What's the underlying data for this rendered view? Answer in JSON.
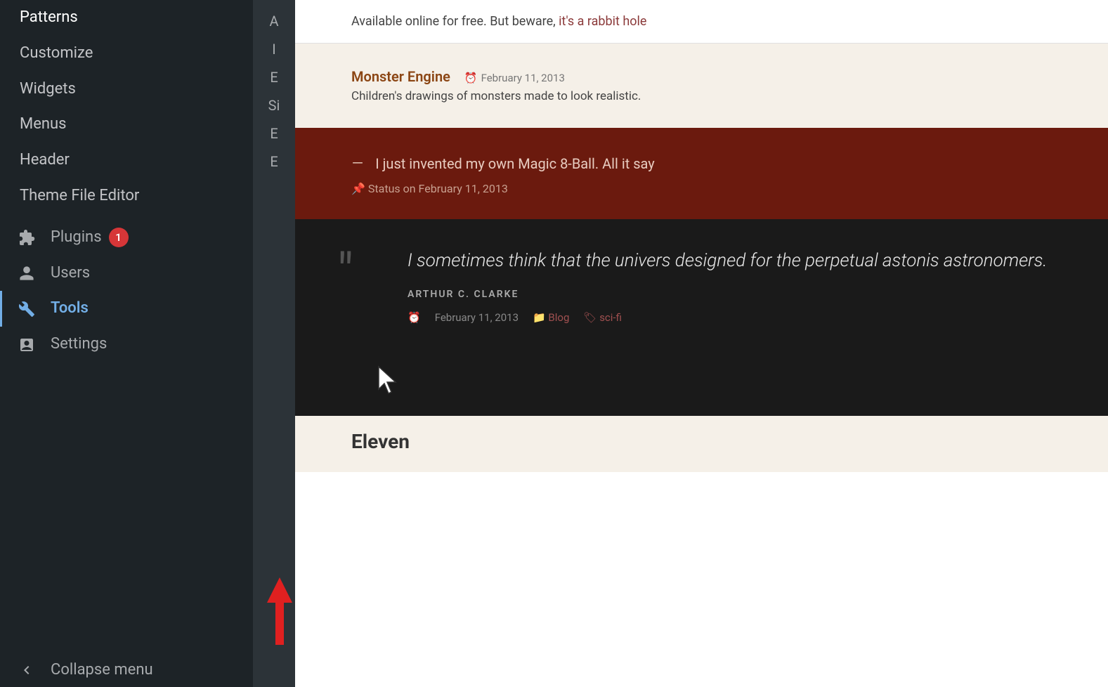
{
  "sidebar": {
    "items": [
      {
        "id": "patterns",
        "label": "Patterns",
        "icon": "",
        "hasIcon": false
      },
      {
        "id": "customize",
        "label": "Customize",
        "icon": "",
        "hasIcon": false
      },
      {
        "id": "widgets",
        "label": "Widgets",
        "icon": "",
        "hasIcon": false
      },
      {
        "id": "menus",
        "label": "Menus",
        "icon": "",
        "hasIcon": false
      },
      {
        "id": "header",
        "label": "Header",
        "icon": "",
        "hasIcon": false
      },
      {
        "id": "theme-file-editor",
        "label": "Theme File Editor",
        "icon": "",
        "hasIcon": false
      }
    ],
    "main_items": [
      {
        "id": "plugins",
        "label": "Plugins",
        "icon": "🔌",
        "badge": "1",
        "active": false
      },
      {
        "id": "users",
        "label": "Users",
        "icon": "👤",
        "badge": null,
        "active": false
      },
      {
        "id": "tools",
        "label": "Tools",
        "icon": "🔧",
        "badge": null,
        "active": true
      },
      {
        "id": "settings",
        "label": "Settings",
        "icon": "⬆",
        "badge": null,
        "active": false
      }
    ],
    "collapse_label": "Collapse menu",
    "submenu_letters": [
      "A",
      "I",
      "E",
      "Si",
      "E",
      "E"
    ]
  },
  "preview": {
    "header_text": "Available online for free. But beware,",
    "header_link_text": "it's a rabbit hole",
    "section1": {
      "post_name": "Monster Engine",
      "post_date": "February 11, 2013",
      "post_desc": "Children's drawings of monsters made to look realistic."
    },
    "section2": {
      "quote_prefix": "–",
      "quote_text": "I just invented my own Magic 8-Ball. All it say",
      "status_label": "Status on February 11, 2013"
    },
    "section3": {
      "quote_text": "I sometimes think that the univers designed for the perpetual astonis astronomers.",
      "quote_author": "ARTHUR C. CLARKE",
      "date": "February 11, 2013",
      "category": "Blog",
      "tag": "sci-fi"
    },
    "section4": {
      "title": "Eleven"
    }
  },
  "arrow": {
    "color": "#e02020"
  },
  "colors": {
    "sidebar_bg": "#1d2327",
    "sidebar_active": "#72aee6",
    "badge_red": "#d63638",
    "preview_cream": "#f5f0e8",
    "preview_brown": "#6b1a0e",
    "preview_dark": "#1a1a1a"
  }
}
